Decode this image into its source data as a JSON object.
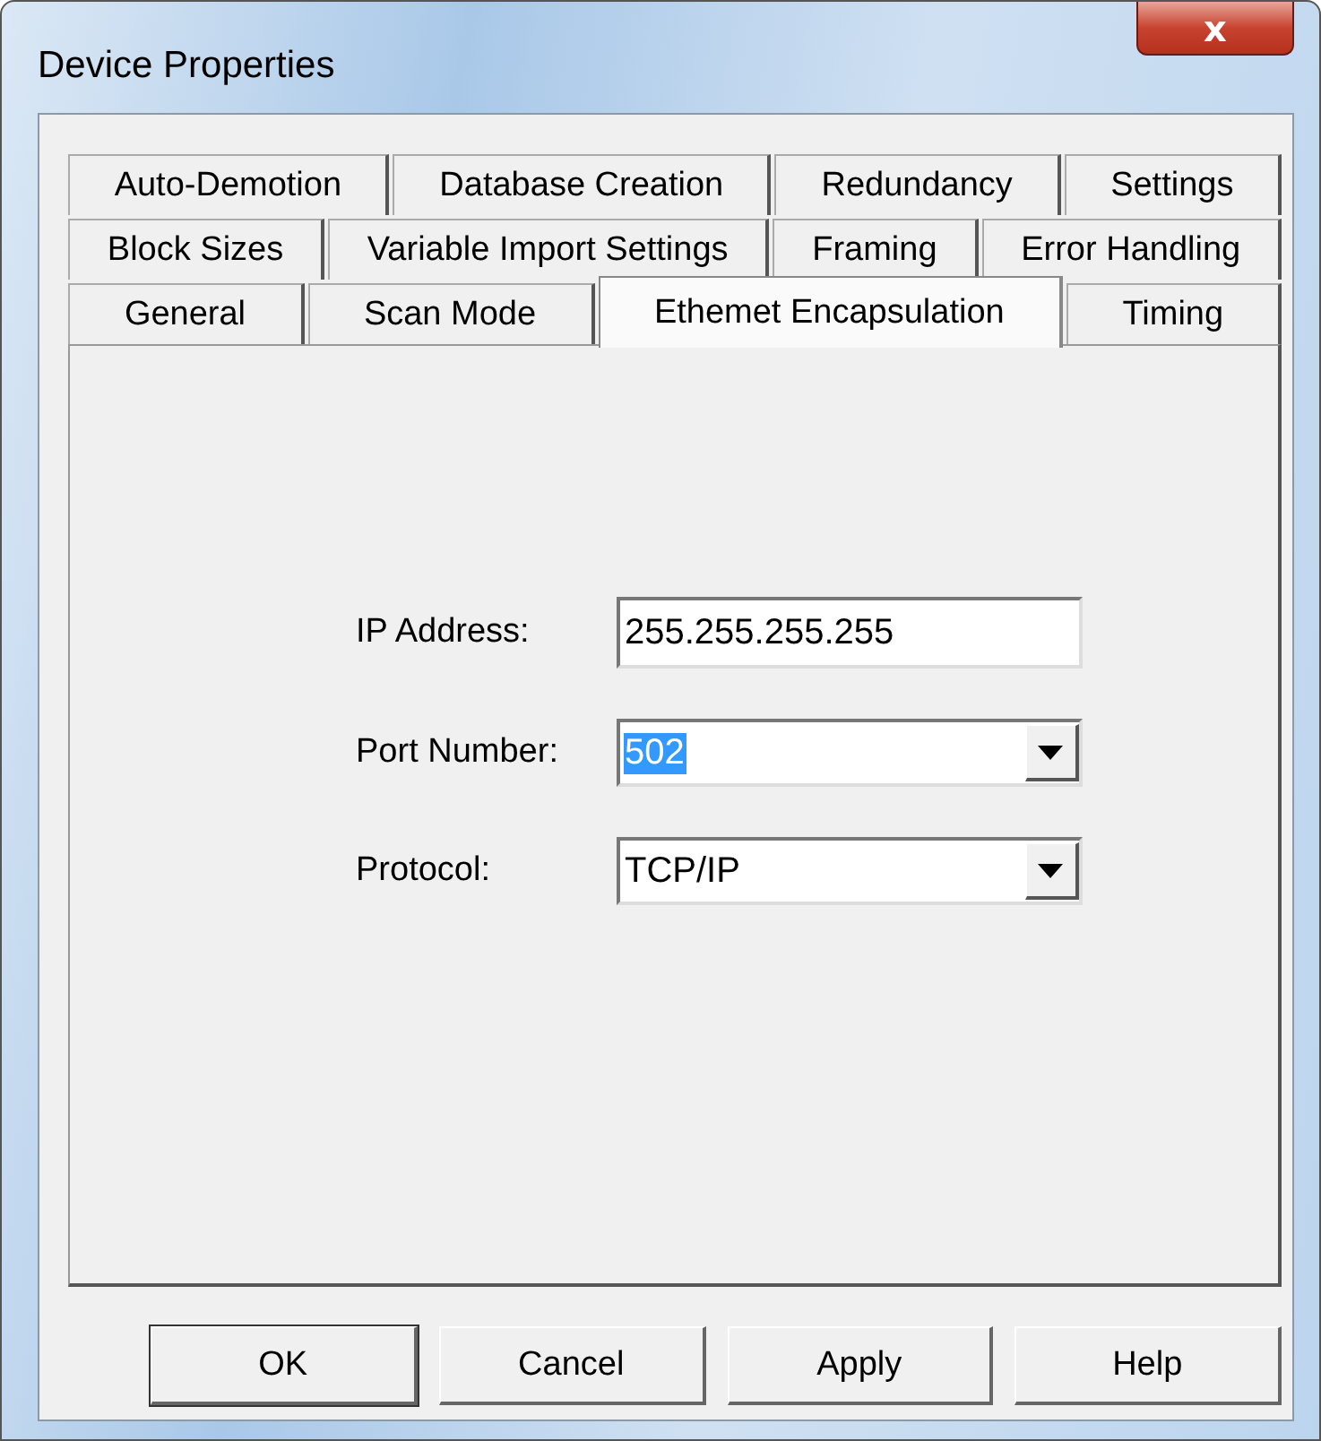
{
  "window": {
    "title": "Device Properties",
    "close": "x"
  },
  "tab_rows": [
    [
      {
        "label": "Auto-Demotion",
        "selected": false
      },
      {
        "label": "Database Creation",
        "selected": false
      },
      {
        "label": "Redundancy",
        "selected": false
      },
      {
        "label": "Settings",
        "selected": false
      }
    ],
    [
      {
        "label": "Block Sizes",
        "selected": false
      },
      {
        "label": "Variable Import Settings",
        "selected": false
      },
      {
        "label": "Framing",
        "selected": false
      },
      {
        "label": "Error Handling",
        "selected": false
      }
    ],
    [
      {
        "label": "General",
        "selected": false
      },
      {
        "label": "Scan Mode",
        "selected": false
      },
      {
        "label": "Ethemet Encapsulation",
        "selected": true
      },
      {
        "label": "Timing",
        "selected": false
      }
    ]
  ],
  "fields": [
    {
      "kind": "text",
      "label": "IP Address:",
      "value": "255.255.255.255",
      "highlighted": false
    },
    {
      "kind": "dropdown",
      "label": "Port Number:",
      "value": "502",
      "highlighted": true
    },
    {
      "kind": "dropdown",
      "label": "Protocol:",
      "value": "TCP/IP",
      "highlighted": false
    }
  ],
  "buttons": [
    {
      "label": "OK",
      "default": true
    },
    {
      "label": "Cancel",
      "default": false
    },
    {
      "label": "Apply",
      "default": false
    },
    {
      "label": "Help",
      "default": false
    }
  ]
}
